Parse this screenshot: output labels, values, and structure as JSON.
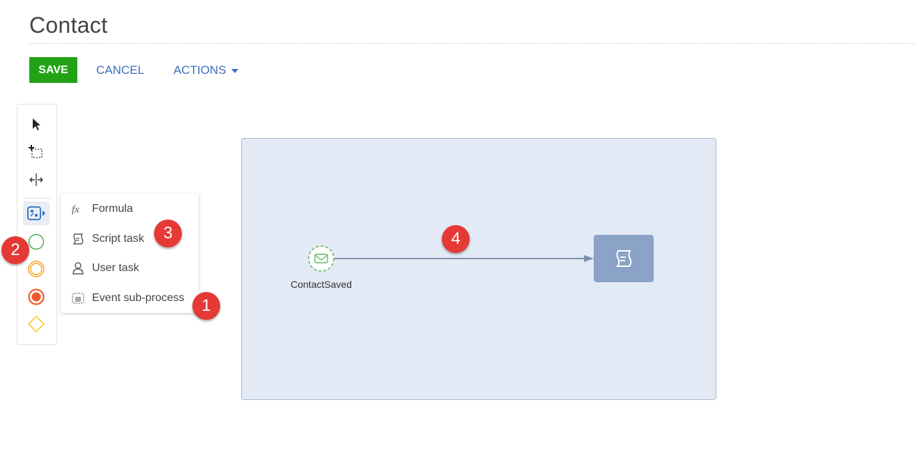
{
  "header": {
    "title": "Contact"
  },
  "toolbar": {
    "save_label": "SAVE",
    "cancel_label": "CANCEL",
    "actions_label": "ACTIONS"
  },
  "palette": {
    "tools": [
      "pointer-tool",
      "lasso-tool",
      "space-tool",
      "element-group-tool",
      "start-event",
      "intermediate-event",
      "end-event",
      "gateway"
    ],
    "colors": {
      "start": "#4caf50",
      "intermediate": "#f5a623",
      "end": "#f05a28",
      "gateway": "#f5c518"
    }
  },
  "menu": {
    "items": [
      {
        "label": "Formula"
      },
      {
        "label": "Script task"
      },
      {
        "label": "User task"
      },
      {
        "label": "Event sub-process"
      }
    ]
  },
  "badges": {
    "b1": "1",
    "b2": "2",
    "b3": "3",
    "b4": "4"
  },
  "diagram": {
    "event_label": "ContactSaved",
    "colors": {
      "canvas": "#e3eaf5",
      "task": "#8aa3c7",
      "flow": "#7d8fae"
    }
  }
}
